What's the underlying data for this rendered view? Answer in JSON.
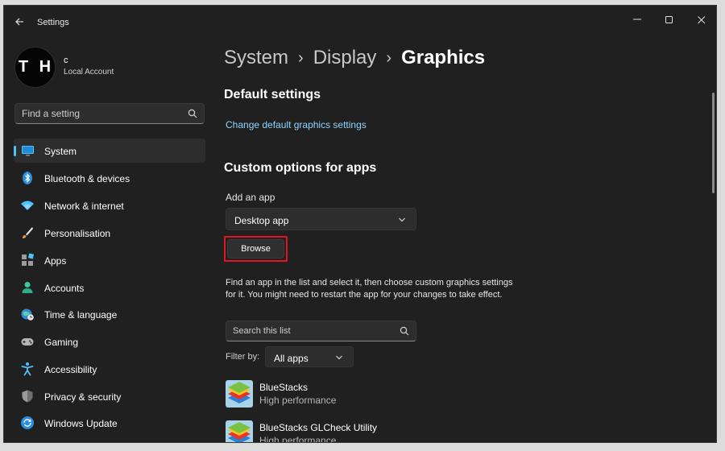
{
  "window": {
    "title": "Settings"
  },
  "user": {
    "initials": "T H",
    "name": "c",
    "account_type": "Local Account"
  },
  "sidebar": {
    "search_placeholder": "Find a setting",
    "items": [
      {
        "label": "System",
        "icon": "monitor-icon",
        "active": true
      },
      {
        "label": "Bluetooth & devices",
        "icon": "bluetooth-icon"
      },
      {
        "label": "Network & internet",
        "icon": "wifi-icon"
      },
      {
        "label": "Personalisation",
        "icon": "brush-icon"
      },
      {
        "label": "Apps",
        "icon": "apps-icon"
      },
      {
        "label": "Accounts",
        "icon": "person-icon"
      },
      {
        "label": "Time & language",
        "icon": "globe-clock-icon"
      },
      {
        "label": "Gaming",
        "icon": "gamepad-icon"
      },
      {
        "label": "Accessibility",
        "icon": "accessibility-icon"
      },
      {
        "label": "Privacy & security",
        "icon": "shield-icon"
      },
      {
        "label": "Windows Update",
        "icon": "update-icon"
      }
    ]
  },
  "breadcrumb": [
    "System",
    "Display",
    "Graphics"
  ],
  "main": {
    "default_heading": "Default settings",
    "default_link": "Change default graphics settings",
    "custom_heading": "Custom options for apps",
    "add_app_label": "Add an app",
    "app_type_selected": "Desktop app",
    "browse_label": "Browse",
    "description": "Find an app in the list and select it, then choose custom graphics settings for it. You might need to restart the app for your changes to take effect.",
    "list_search_placeholder": "Search this list",
    "filter_label": "Filter by:",
    "filter_selected": "All apps",
    "apps": [
      {
        "name": "BlueStacks",
        "preference": "High performance"
      },
      {
        "name": "BlueStacks GLCheck Utility",
        "preference": "High performance"
      }
    ]
  },
  "colors": {
    "accent": "#4cc2ff",
    "link": "#8fd3ff",
    "highlight": "#e0161c",
    "background": "#202020"
  }
}
